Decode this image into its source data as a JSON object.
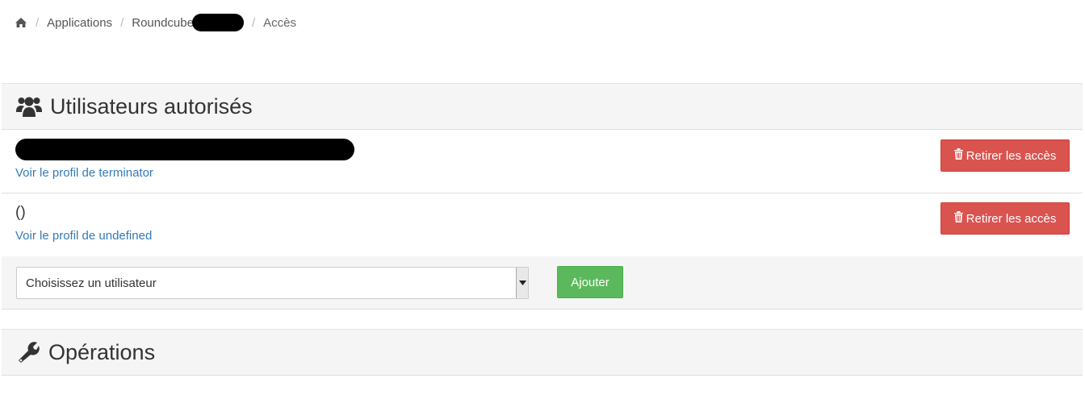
{
  "breadcrumb": {
    "home_icon": "home-icon",
    "items": [
      "Applications",
      "Roundcube",
      "Accès"
    ]
  },
  "authorized_users": {
    "icon": "users-icon",
    "title": "Utilisateurs autorisés",
    "rows": [
      {
        "name": "",
        "profile_link": "Voir le profil de terminator",
        "remove_label": "Retirer les accès"
      },
      {
        "name": "()",
        "profile_link": "Voir le profil de undefined",
        "remove_label": "Retirer les accès"
      }
    ],
    "add": {
      "select_value": "Choisissez un utilisateur",
      "button_label": "Ajouter"
    }
  },
  "operations": {
    "icon": "wrench-icon",
    "title": "Opérations"
  },
  "colors": {
    "danger": "#d9534f",
    "success": "#5cb85c",
    "link": "#337ab7",
    "panel_bg": "#f5f5f5"
  }
}
